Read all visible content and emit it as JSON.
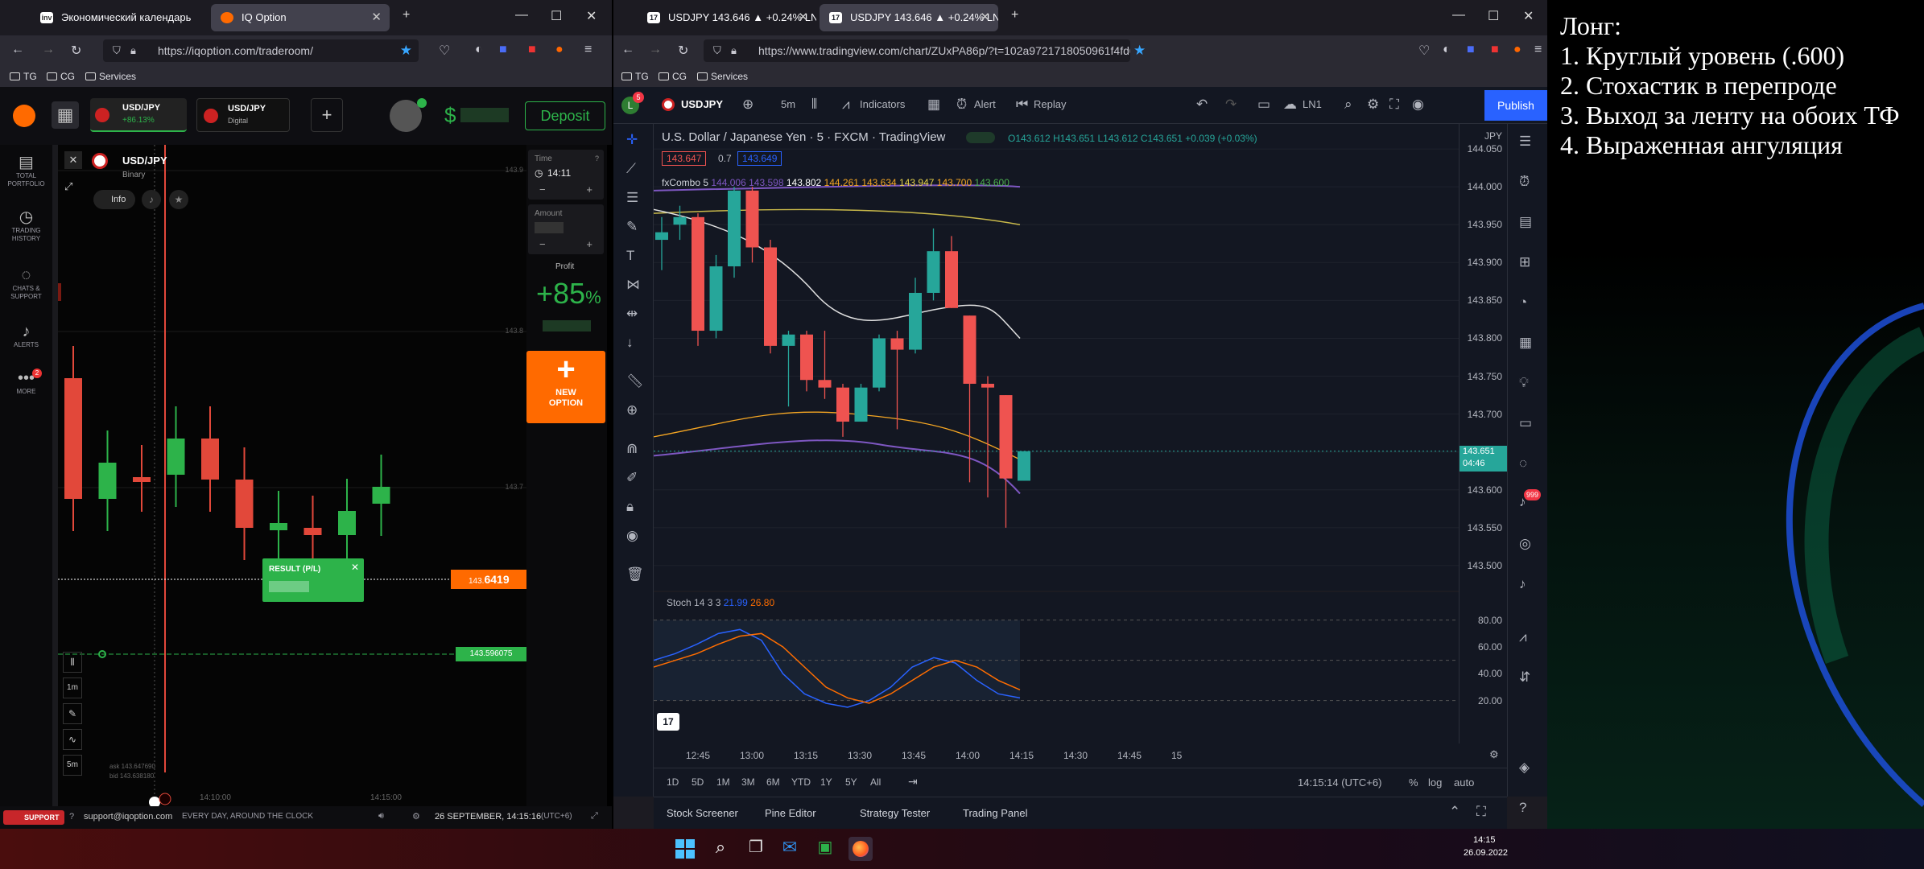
{
  "left_browser": {
    "tabs": [
      {
        "icon": "inv",
        "label": "Экономический календарь —"
      },
      {
        "icon": "iq",
        "label": "IQ Option"
      }
    ],
    "url": "https://iqoption.com/traderoom/",
    "bookmarks": [
      "TG",
      "CG",
      "Services"
    ]
  },
  "iq": {
    "asset_tabs": [
      {
        "name": "USD/JPY",
        "sub": "+86.13%"
      },
      {
        "name": "USD/JPY",
        "sub": "Digital"
      }
    ],
    "add_tab": "+",
    "balance_symbol": "$",
    "deposit": "Deposit",
    "sidebar": [
      {
        "icon": "briefcase-icon",
        "label": "TOTAL PORTFOLIO"
      },
      {
        "icon": "history-icon",
        "label": "TRADING HISTORY"
      },
      {
        "icon": "chat-icon",
        "label": "CHATS & SUPPORT"
      },
      {
        "icon": "bell-icon",
        "label": "ALERTS"
      },
      {
        "icon": "more-icon",
        "label": "MORE",
        "badge": "2"
      }
    ],
    "asset": {
      "name": "USD/JPY",
      "type": "Binary",
      "info": "Info"
    },
    "time": {
      "label": "Time",
      "value": "14:11"
    },
    "amount": {
      "label": "Amount"
    },
    "profit": {
      "label": "Profit",
      "value": "+85",
      "unit": "%"
    },
    "new_option": "NEW OPTION",
    "price_levels": [
      "143.9",
      "143.8",
      "143.7"
    ],
    "current_price_prefix": "143.",
    "current_price_main": "6419",
    "green_line_price": "143.596075",
    "result": {
      "title": "RESULT (P/L)"
    },
    "ask": "ask 143.647690",
    "bid": "bid 143.638180",
    "time_labels": [
      "14:10:00",
      "14:15:00"
    ],
    "timeframe_buttons": [
      "1m",
      "5m"
    ],
    "footer": {
      "support": "SUPPORT",
      "email": "support@iqoption.com",
      "hours": "EVERY DAY, AROUND THE CLOCK",
      "datetime": "26 SEPTEMBER, 14:15:16",
      "tz": "(UTC+6)"
    }
  },
  "right_browser": {
    "tabs": [
      {
        "label": "USDJPY 143.646 ▲ +0.24% LN1"
      },
      {
        "label": "USDJPY 143.646 ▲ +0.24% LN1"
      }
    ],
    "url": "https://www.tradingview.com/chart/ZUxPA86p/?t=102a9721718050961f4fd03637f4d3%3Fc",
    "bookmarks": [
      "TG",
      "CG",
      "Services"
    ]
  },
  "tv": {
    "avatar": "L",
    "avatar_badge": "5",
    "symbol": "USDJPY",
    "interval": "5m",
    "toolbar": {
      "indicators": "Indicators",
      "alert": "Alert",
      "replay": "Replay",
      "layout": "LN1",
      "publish": "Publish"
    },
    "title": "U.S. Dollar / Japanese Yen · 5 · FXCM · TradingView",
    "ohlc": {
      "o": "O143.612",
      "h": "H143.651",
      "l": "L143.612",
      "c": "C143.651",
      "chg": "+0.039 (+0.03%)"
    },
    "bid_box": "143.647",
    "spread": "0.7",
    "ask_box": "143.649",
    "fxcombo": {
      "label": "fxCombo 5",
      "values": [
        "144.006",
        "143.598",
        "143.802",
        "144.261",
        "143.634",
        "143.947",
        "143.700",
        "143.600"
      ]
    },
    "currency": "JPY",
    "y_labels": [
      "144.050",
      "144.000",
      "143.950",
      "143.900",
      "143.850",
      "143.800",
      "143.750",
      "143.700",
      "143.650",
      "143.600",
      "143.550",
      "143.500"
    ],
    "last_price": "143.651",
    "countdown": "04:46",
    "stoch": {
      "label": "Stoch 14 3 3",
      "k": "21.99",
      "d": "26.80",
      "levels": [
        "80.00",
        "60.00",
        "40.00",
        "20.00"
      ]
    },
    "x_labels": [
      "12:45",
      "13:00",
      "13:15",
      "13:30",
      "13:45",
      "14:00",
      "14:15",
      "14:30",
      "14:45",
      "15"
    ],
    "ranges": [
      "1D",
      "5D",
      "1M",
      "3M",
      "6M",
      "YTD",
      "1Y",
      "5Y",
      "All"
    ],
    "clock": "14:15:14 (UTC+6)",
    "scale_opts": [
      "%",
      "log",
      "auto"
    ],
    "bottom_tabs": [
      "Stock Screener",
      "Pine Editor",
      "Strategy Tester",
      "Trading Panel"
    ],
    "right_badge": "999"
  },
  "notes": {
    "title": "Лонг:",
    "items": [
      "1. Круглый уровень (.600)",
      "2. Стохастик в перепроде",
      "3. Выход за ленту на обоих ТФ",
      "4. Выраженная ангуляция"
    ]
  },
  "taskbar": {
    "time": "14:15",
    "date": "26.09.2022"
  },
  "colors": {
    "up": "#26a69a",
    "down": "#ef5350",
    "iq_up": "#2db34a",
    "iq_down": "#e2483a",
    "iq_orange": "#ff6a00"
  },
  "chart_data": {
    "type": "candlestick",
    "tv_candles": [
      {
        "t": "12:40",
        "o": 143.93,
        "h": 143.96,
        "l": 143.89,
        "c": 143.94
      },
      {
        "t": "12:45",
        "o": 143.95,
        "h": 143.975,
        "l": 143.93,
        "c": 143.96
      },
      {
        "t": "12:50",
        "o": 143.96,
        "h": 143.965,
        "l": 143.79,
        "c": 143.81
      },
      {
        "t": "12:55",
        "o": 143.81,
        "h": 143.91,
        "l": 143.8,
        "c": 143.895
      },
      {
        "t": "13:00",
        "o": 143.895,
        "h": 144.0,
        "l": 143.88,
        "c": 143.995
      },
      {
        "t": "13:05",
        "o": 143.995,
        "h": 144.0,
        "l": 143.9,
        "c": 143.92
      },
      {
        "t": "13:10",
        "o": 143.92,
        "h": 143.93,
        "l": 143.78,
        "c": 143.79
      },
      {
        "t": "13:15",
        "o": 143.79,
        "h": 143.81,
        "l": 143.71,
        "c": 143.805
      },
      {
        "t": "13:20",
        "o": 143.805,
        "h": 143.81,
        "l": 143.73,
        "c": 143.745
      },
      {
        "t": "13:25",
        "o": 143.745,
        "h": 143.81,
        "l": 143.72,
        "c": 143.735
      },
      {
        "t": "13:30",
        "o": 143.735,
        "h": 143.74,
        "l": 143.67,
        "c": 143.69
      },
      {
        "t": "13:35",
        "o": 143.69,
        "h": 143.74,
        "l": 143.69,
        "c": 143.735
      },
      {
        "t": "13:40",
        "o": 143.735,
        "h": 143.805,
        "l": 143.73,
        "c": 143.8
      },
      {
        "t": "13:45",
        "o": 143.8,
        "h": 143.81,
        "l": 143.68,
        "c": 143.785
      },
      {
        "t": "13:50",
        "o": 143.785,
        "h": 143.88,
        "l": 143.78,
        "c": 143.86
      },
      {
        "t": "13:55",
        "o": 143.86,
        "h": 143.945,
        "l": 143.85,
        "c": 143.915
      },
      {
        "t": "14:00",
        "o": 143.915,
        "h": 143.935,
        "l": 143.84,
        "c": 143.84
      },
      {
        "t": "14:05",
        "o": 143.83,
        "h": 143.83,
        "l": 143.61,
        "c": 143.74
      },
      {
        "t": "14:10",
        "o": 143.74,
        "h": 143.75,
        "l": 143.59,
        "c": 143.735
      },
      {
        "t": "14:15",
        "o": 143.725,
        "h": 143.725,
        "l": 143.55,
        "c": 143.615
      },
      {
        "t": "14:20",
        "o": 143.612,
        "h": 143.651,
        "l": 143.612,
        "c": 143.651
      }
    ],
    "stoch_k": [
      50,
      55,
      62,
      70,
      73,
      65,
      40,
      25,
      18,
      15,
      20,
      30,
      45,
      52,
      48,
      35,
      25,
      22
    ],
    "stoch_d": [
      45,
      50,
      55,
      62,
      68,
      70,
      60,
      45,
      30,
      22,
      18,
      25,
      35,
      45,
      50,
      45,
      35,
      28
    ],
    "iq_candles": [
      {
        "o": 0.3,
        "c": 0.8,
        "dir": "down"
      },
      {
        "o": 0.8,
        "c": 0.65,
        "dir": "up"
      },
      {
        "o": 0.71,
        "c": 0.72,
        "dir": "down"
      },
      {
        "o": 0.7,
        "c": 0.55,
        "dir": "up"
      },
      {
        "o": 0.55,
        "c": 0.72,
        "dir": "down"
      },
      {
        "o": 0.72,
        "c": 0.92,
        "dir": "down"
      },
      {
        "o": 0.93,
        "c": 0.9,
        "dir": "up"
      },
      {
        "o": 0.92,
        "c": 0.95,
        "dir": "down"
      },
      {
        "o": 0.95,
        "c": 0.85,
        "dir": "up"
      },
      {
        "o": 0.82,
        "c": 0.75,
        "dir": "up"
      }
    ]
  }
}
